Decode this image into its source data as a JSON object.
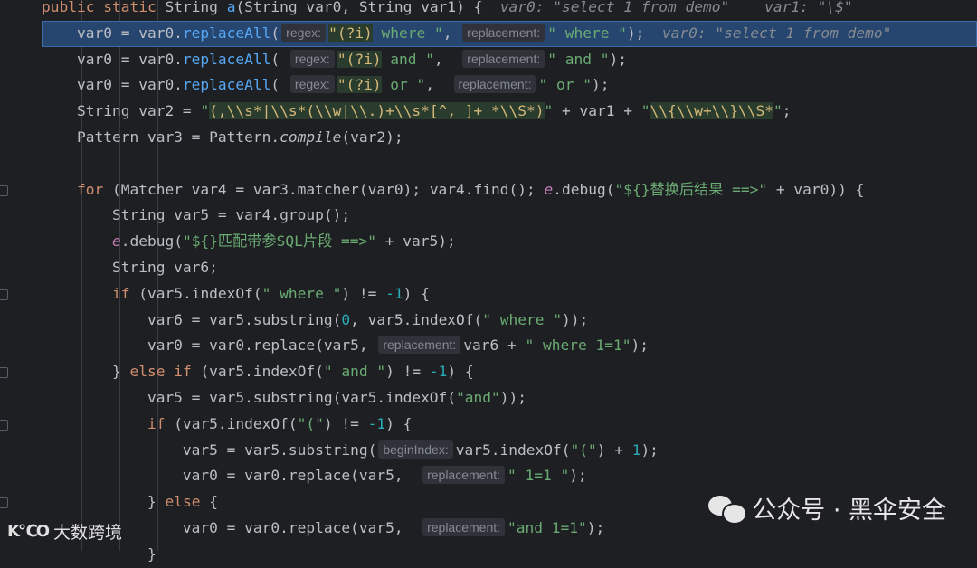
{
  "editor": {
    "lines": [
      {
        "segments": [
          {
            "t": "public static ",
            "c": "kw"
          },
          {
            "t": "String "
          },
          {
            "t": "a",
            "c": "fn"
          },
          {
            "t": "(String var0, String var1) {  "
          },
          {
            "t": "var0: \"select 1 from demo\"    var1: \"\\$\"",
            "c": "val"
          }
        ]
      },
      {
        "current": true,
        "segments": [
          {
            "t": "    var0 = var0."
          },
          {
            "t": "replaceAll",
            "c": "fn"
          },
          {
            "t": "("
          },
          {
            "hint": "regex:"
          },
          {
            "t": "\"(?i)",
            "c": "rebg"
          },
          {
            "t": " where \"",
            "c": "str"
          },
          {
            "t": ", "
          },
          {
            "hint": "replacement:"
          },
          {
            "t": "\" where \"",
            "c": "str"
          },
          {
            "t": ");  "
          },
          {
            "t": "var0: \"select 1 from demo\"",
            "c": "val"
          }
        ]
      },
      {
        "segments": [
          {
            "t": "    var0 = var0."
          },
          {
            "t": "replaceAll",
            "c": "fn"
          },
          {
            "t": "( "
          },
          {
            "hint": "regex:"
          },
          {
            "t": "\"(?i)",
            "c": "rebg"
          },
          {
            "t": " and \"",
            "c": "str"
          },
          {
            "t": ",  "
          },
          {
            "hint": "replacement:"
          },
          {
            "t": "\" and \"",
            "c": "str"
          },
          {
            "t": ");"
          }
        ]
      },
      {
        "segments": [
          {
            "t": "    var0 = var0."
          },
          {
            "t": "replaceAll",
            "c": "fn"
          },
          {
            "t": "( "
          },
          {
            "hint": "regex:"
          },
          {
            "t": "\"(?i)",
            "c": "rebg"
          },
          {
            "t": " or \"",
            "c": "str"
          },
          {
            "t": ",  "
          },
          {
            "hint": "replacement:"
          },
          {
            "t": "\" or \"",
            "c": "str"
          },
          {
            "t": ");"
          }
        ]
      },
      {
        "segments": [
          {
            "t": "    String var2 = "
          },
          {
            "t": "\"",
            "c": "str"
          },
          {
            "t": "(,\\\\s*|\\\\s*(\\\\w|\\\\.)+\\\\s*[^, ]+ *\\\\S*)",
            "c": "rebg"
          },
          {
            "t": "\"",
            "c": "str"
          },
          {
            "t": " + var1 + "
          },
          {
            "t": "\"",
            "c": "str"
          },
          {
            "t": "\\\\{\\\\w+\\\\}\\\\S*",
            "c": "rebg"
          },
          {
            "t": "\"",
            "c": "str"
          },
          {
            "t": ";"
          }
        ]
      },
      {
        "segments": [
          {
            "t": "    Pattern var3 = Pattern."
          },
          {
            "t": "compile",
            "c": "it"
          },
          {
            "t": "(var2);"
          }
        ]
      },
      {
        "segments": [
          {
            "t": ""
          }
        ]
      },
      {
        "fold": true,
        "segments": [
          {
            "t": "    "
          },
          {
            "t": "for ",
            "c": "kw"
          },
          {
            "t": "(Matcher var4 = var3.matcher(var0); var4.find(); "
          },
          {
            "t": "e",
            "c": "field it"
          },
          {
            "t": ".debug("
          },
          {
            "t": "\"${}替换后结果 ==>\"",
            "c": "str"
          },
          {
            "t": " + var0)) {"
          }
        ]
      },
      {
        "segments": [
          {
            "t": "        String var5 = var4.group();"
          }
        ]
      },
      {
        "segments": [
          {
            "t": "        "
          },
          {
            "t": "e",
            "c": "field it"
          },
          {
            "t": ".debug("
          },
          {
            "t": "\"${}匹配带参SQL片段 ==>\"",
            "c": "str"
          },
          {
            "t": " + var5);"
          }
        ]
      },
      {
        "segments": [
          {
            "t": "        String var6;"
          }
        ]
      },
      {
        "fold": true,
        "segments": [
          {
            "t": "        "
          },
          {
            "t": "if ",
            "c": "kw"
          },
          {
            "t": "(var5.indexOf("
          },
          {
            "t": "\" where \"",
            "c": "str"
          },
          {
            "t": ") != "
          },
          {
            "t": "-1",
            "c": "num"
          },
          {
            "t": ") {"
          }
        ]
      },
      {
        "segments": [
          {
            "t": "            var6 = var5.substring("
          },
          {
            "t": "0",
            "c": "num"
          },
          {
            "t": ", var5.indexOf("
          },
          {
            "t": "\" where \"",
            "c": "str"
          },
          {
            "t": "));"
          }
        ]
      },
      {
        "segments": [
          {
            "t": "            var0 = var0.replace(var5, "
          },
          {
            "hint": "replacement:"
          },
          {
            "t": "var6 + "
          },
          {
            "t": "\" where 1=1\"",
            "c": "str"
          },
          {
            "t": ");"
          }
        ]
      },
      {
        "fold": true,
        "segments": [
          {
            "t": "        } "
          },
          {
            "t": "else if ",
            "c": "kw"
          },
          {
            "t": "(var5.indexOf("
          },
          {
            "t": "\" and \"",
            "c": "str"
          },
          {
            "t": ") != "
          },
          {
            "t": "-1",
            "c": "num"
          },
          {
            "t": ") {"
          }
        ]
      },
      {
        "segments": [
          {
            "t": "            var5 = var5.substring(var5.indexOf("
          },
          {
            "t": "\"and\"",
            "c": "str"
          },
          {
            "t": "));"
          }
        ]
      },
      {
        "fold": true,
        "segments": [
          {
            "t": "            "
          },
          {
            "t": "if ",
            "c": "kw"
          },
          {
            "t": "(var5.indexOf("
          },
          {
            "t": "\"(\"",
            "c": "str"
          },
          {
            "t": ") != "
          },
          {
            "t": "-1",
            "c": "num"
          },
          {
            "t": ") {"
          }
        ]
      },
      {
        "segments": [
          {
            "t": "                var5 = var5.substring("
          },
          {
            "hint": "beginIndex:"
          },
          {
            "t": "var5.indexOf("
          },
          {
            "t": "\"(\"",
            "c": "str"
          },
          {
            "t": ") + "
          },
          {
            "t": "1",
            "c": "num"
          },
          {
            "t": ");"
          }
        ]
      },
      {
        "segments": [
          {
            "t": "                var0 = var0.replace(var5,  "
          },
          {
            "hint": "replacement:"
          },
          {
            "t": "\" 1=1 \"",
            "c": "str"
          },
          {
            "t": ");"
          }
        ]
      },
      {
        "fold": true,
        "segments": [
          {
            "t": "            } "
          },
          {
            "t": "else ",
            "c": "kw"
          },
          {
            "t": "{"
          }
        ]
      },
      {
        "segments": [
          {
            "t": "                var0 = var0.replace(var5,  "
          },
          {
            "hint": "replacement:"
          },
          {
            "t": "\"and 1=1\"",
            "c": "str"
          },
          {
            "t": ");"
          }
        ]
      },
      {
        "segments": [
          {
            "t": "            }"
          }
        ]
      }
    ]
  },
  "watermark": {
    "text": "公众号 · 黑伞安全",
    "icon": "wechat-icon"
  },
  "logo": {
    "mark": "K℃O",
    "text": "大数跨境"
  },
  "colors": {
    "background": "#1e1f22",
    "current_line": "#26466f",
    "keyword": "#cf8e6d",
    "string": "#6aab73",
    "method": "#56a8f5",
    "number": "#2aacb8"
  }
}
